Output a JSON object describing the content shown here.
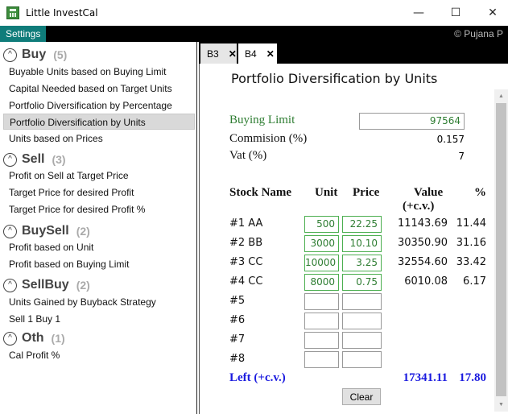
{
  "window": {
    "title": "Little InvestCal",
    "minimize_icon": "—",
    "maximize_icon": "☐",
    "close_icon": "✕"
  },
  "menu": {
    "settings": "Settings",
    "copyright": "© Pujana P"
  },
  "sidebar": {
    "categories": [
      {
        "name": "Buy",
        "count": "(5)",
        "items": [
          "Buyable Units based on Buying Limit",
          "Capital Needed based on Target Units",
          "Portfolio Diversification by Percentage",
          "Portfolio Diversification by Units",
          "Units based on Prices"
        ]
      },
      {
        "name": "Sell",
        "count": "(3)",
        "items": [
          "Profit on Sell at Target Price",
          "Target Price for desired Profit",
          "Target Price for desired Profit %"
        ]
      },
      {
        "name": "BuySell",
        "count": "(2)",
        "items": [
          "Profit based on Unit",
          "Profit based on Buying Limit"
        ]
      },
      {
        "name": "SellBuy",
        "count": "(2)",
        "items": [
          "Units Gained by Buyback Strategy",
          "Sell 1 Buy 1"
        ]
      },
      {
        "name": "Oth",
        "count": "(1)",
        "items": [
          "Cal Profit %"
        ]
      }
    ],
    "collapse_glyph": "^",
    "selected_item": "Portfolio Diversification by Units"
  },
  "tabs": [
    {
      "label": "B3",
      "close": "✕"
    },
    {
      "label": "B4",
      "close": "✕"
    }
  ],
  "calculator": {
    "title": "Portfolio Diversification by Units",
    "buying_limit_label": "Buying Limit",
    "buying_limit_value": "97564",
    "commission_label": "Commision (%)",
    "commission_value": "0.157",
    "vat_label": "Vat (%)",
    "vat_value": "7",
    "headers": {
      "stock": "Stock Name",
      "unit": "Unit",
      "price": "Price",
      "value": "Value",
      "value_sub": "(+c.v.)",
      "pct": "%"
    },
    "rows": [
      {
        "name": "#1 AA",
        "unit": "500",
        "price": "22.25",
        "value": "11143.69",
        "pct": "11.44"
      },
      {
        "name": "#2 BB",
        "unit": "3000",
        "price": "10.10",
        "value": "30350.90",
        "pct": "31.16"
      },
      {
        "name": "#3 CC",
        "unit": "10000",
        "price": "3.25",
        "value": "32554.60",
        "pct": "33.42"
      },
      {
        "name": "#4 CC",
        "unit": "8000",
        "price": "0.75",
        "value": "6010.08",
        "pct": "6.17"
      },
      {
        "name": "#5",
        "unit": "",
        "price": "",
        "value": "",
        "pct": ""
      },
      {
        "name": "#6",
        "unit": "",
        "price": "",
        "value": "",
        "pct": ""
      },
      {
        "name": "#7",
        "unit": "",
        "price": "",
        "value": "",
        "pct": ""
      },
      {
        "name": "#8",
        "unit": "",
        "price": "",
        "value": "",
        "pct": ""
      }
    ],
    "left_label": "Left (+c.v.)",
    "left_value": "17341.11",
    "left_pct": "17.80",
    "clear_label": "Clear"
  },
  "icons": {
    "app": "calculator-app-icon",
    "scroll_up": "▲",
    "scroll_down": "▼"
  }
}
